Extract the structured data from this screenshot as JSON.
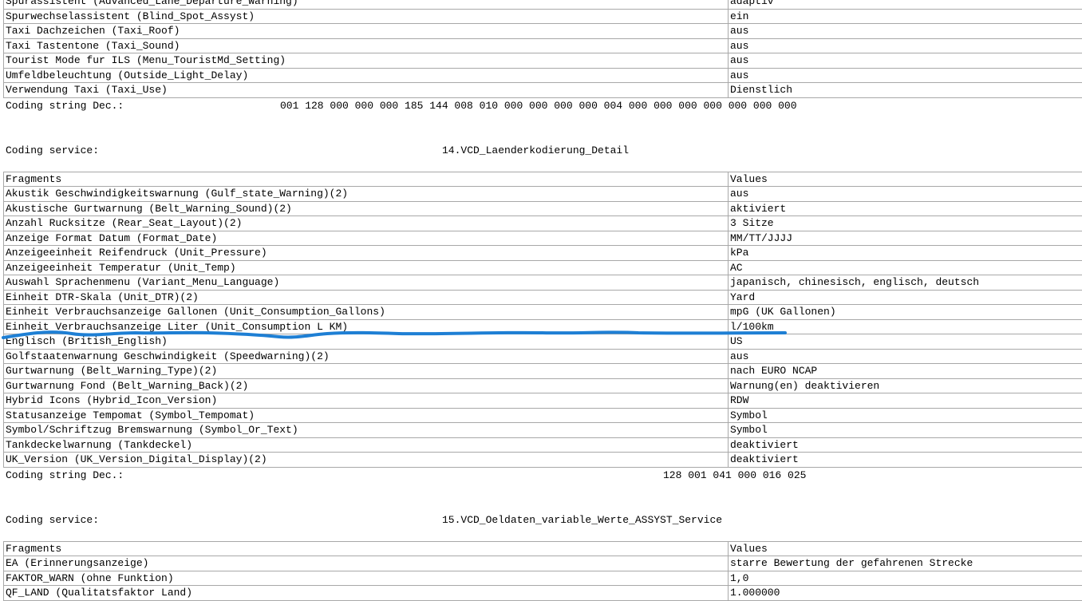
{
  "section13": {
    "rows": [
      {
        "fragment": "Spurassistent (Advanced_Lane_Departure_Warning)",
        "value": "adaptiv"
      },
      {
        "fragment": "Spurwechselassistent (Blind_Spot_Assyst)",
        "value": "ein"
      },
      {
        "fragment": "Taxi Dachzeichen (Taxi_Roof)",
        "value": "aus"
      },
      {
        "fragment": "Taxi Tastentone (Taxi_Sound)",
        "value": "aus"
      },
      {
        "fragment": "Tourist Mode fur ILS (Menu_TouristMd_Setting)",
        "value": "aus"
      },
      {
        "fragment": "Umfeldbeleuchtung (Outside_Light_Delay)",
        "value": "aus"
      },
      {
        "fragment": "Verwendung Taxi (Taxi_Use)",
        "value": "Dienstlich"
      }
    ],
    "coding_label": "Coding string Dec.:",
    "coding_value": "001 128 000 000 000 185 144 008 010 000 000 000 000 004 000 000 000 000 000 000 000"
  },
  "section14": {
    "service_label": "Coding service:",
    "service_name": "14.VCD_Laenderkodierung_Detail",
    "header": {
      "fragment": "Fragments",
      "value": "Values"
    },
    "rows": [
      {
        "fragment": "Akustik Geschwindigkeitswarnung (Gulf_state_Warning)(2)",
        "value": "aus"
      },
      {
        "fragment": "Akustische Gurtwarnung (Belt_Warning_Sound)(2)",
        "value": "aktiviert"
      },
      {
        "fragment": "Anzahl Rucksitze (Rear_Seat_Layout)(2)",
        "value": "3 Sitze"
      },
      {
        "fragment": "Anzeige Format Datum (Format_Date)",
        "value": "MM/TT/JJJJ"
      },
      {
        "fragment": "Anzeigeeinheit Reifendruck (Unit_Pressure)",
        "value": "kPa"
      },
      {
        "fragment": "Anzeigeeinheit Temperatur (Unit_Temp)",
        "value": "AC"
      },
      {
        "fragment": "Auswahl Sprachenmenu (Variant_Menu_Language)",
        "value": "japanisch, chinesisch, englisch, deutsch"
      },
      {
        "fragment": "Einheit DTR-Skala (Unit_DTR)(2)",
        "value": "Yard"
      },
      {
        "fragment": "Einheit Verbrauchsanzeige Gallonen (Unit_Consumption_Gallons)",
        "value": "mpG (UK Gallonen)"
      },
      {
        "fragment": "Einheit Verbrauchsanzeige Liter (Unit_Consumption L KM)",
        "value": "l/100km"
      },
      {
        "fragment": "Englisch (British_English)",
        "value": "US"
      },
      {
        "fragment": "Golfstaatenwarnung Geschwindigkeit (Speedwarning)(2)",
        "value": "aus"
      },
      {
        "fragment": "Gurtwarnung (Belt_Warning_Type)(2)",
        "value": "nach EURO NCAP"
      },
      {
        "fragment": "Gurtwarnung Fond (Belt_Warning_Back)(2)",
        "value": "Warnung(en) deaktivieren"
      },
      {
        "fragment": "Hybrid Icons (Hybrid_Icon_Version)",
        "value": "RDW"
      },
      {
        "fragment": "Statusanzeige Tempomat (Symbol_Tempomat)",
        "value": "Symbol"
      },
      {
        "fragment": "Symbol/Schriftzug Bremswarnung (Symbol_Or_Text)",
        "value": "Symbol"
      },
      {
        "fragment": "Tankdeckelwarnung (Tankdeckel)",
        "value": "deaktiviert"
      },
      {
        "fragment": "UK_Version (UK_Version_Digital_Display)(2)",
        "value": "deaktiviert"
      }
    ],
    "coding_label": "Coding string Dec.:",
    "coding_value": "128 001 041 000 016 025"
  },
  "section15": {
    "service_label": "Coding service:",
    "service_name": "15.VCD_Oeldaten_variable_Werte_ASSYST_Service",
    "header": {
      "fragment": "Fragments",
      "value": "Values"
    },
    "rows": [
      {
        "fragment": "EA (Erinnerungsanzeige)",
        "value": "starre Bewertung der gefahrenen Strecke"
      },
      {
        "fragment": "FAKTOR_WARN (ohne Funktion)",
        "value": "1,0"
      },
      {
        "fragment": "QF_LAND (Qualitatsfaktor Land)",
        "value": "1.000000"
      }
    ]
  },
  "annotation": {
    "color": "#1e7fd4"
  }
}
